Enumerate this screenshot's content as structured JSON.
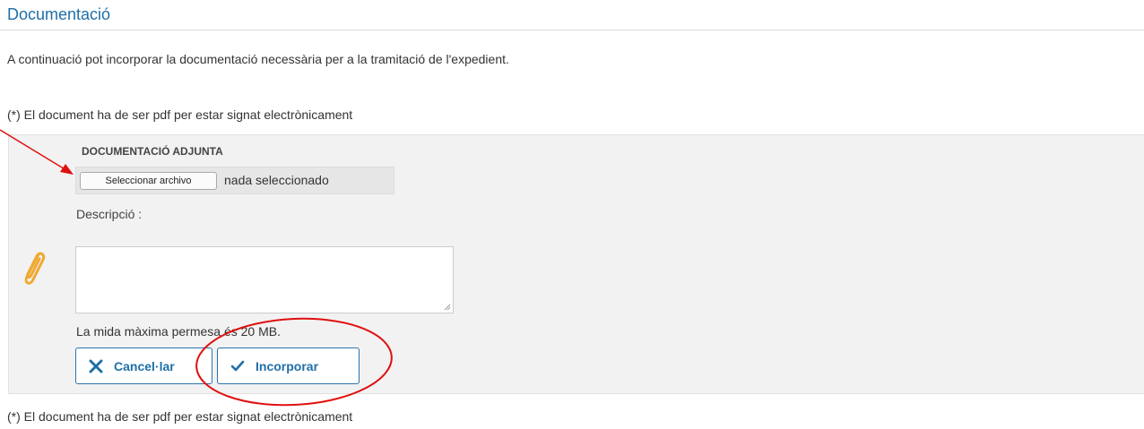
{
  "section": {
    "title": "Documentació",
    "intro": "A continuació pot incorporar la documentació necessària per a la tramitació de l'expedient."
  },
  "notes": {
    "top": "(*) El document ha de ser pdf per estar signat electrònicament",
    "bottom": "(*) El document ha de ser pdf per estar signat electrònicament"
  },
  "attachment": {
    "heading": "DOCUMENTACIÓ ADJUNTA",
    "file_button": "Seleccionar archivo",
    "file_status": "nada seleccionado",
    "description_label": "Descripció :",
    "description_value": "",
    "max_size": "La mida màxima permesa és 20 MB."
  },
  "buttons": {
    "cancel": "Cancel·lar",
    "incorporar": "Incorporar"
  },
  "icons": {
    "clip": "paperclip-icon",
    "cancel": "x-icon",
    "incorporar": "checkmark-icon"
  },
  "colors": {
    "accent": "#1f6fa8",
    "clip": "#f0a830",
    "annotation": "#e01010",
    "panel_bg": "#f2f2f2"
  }
}
